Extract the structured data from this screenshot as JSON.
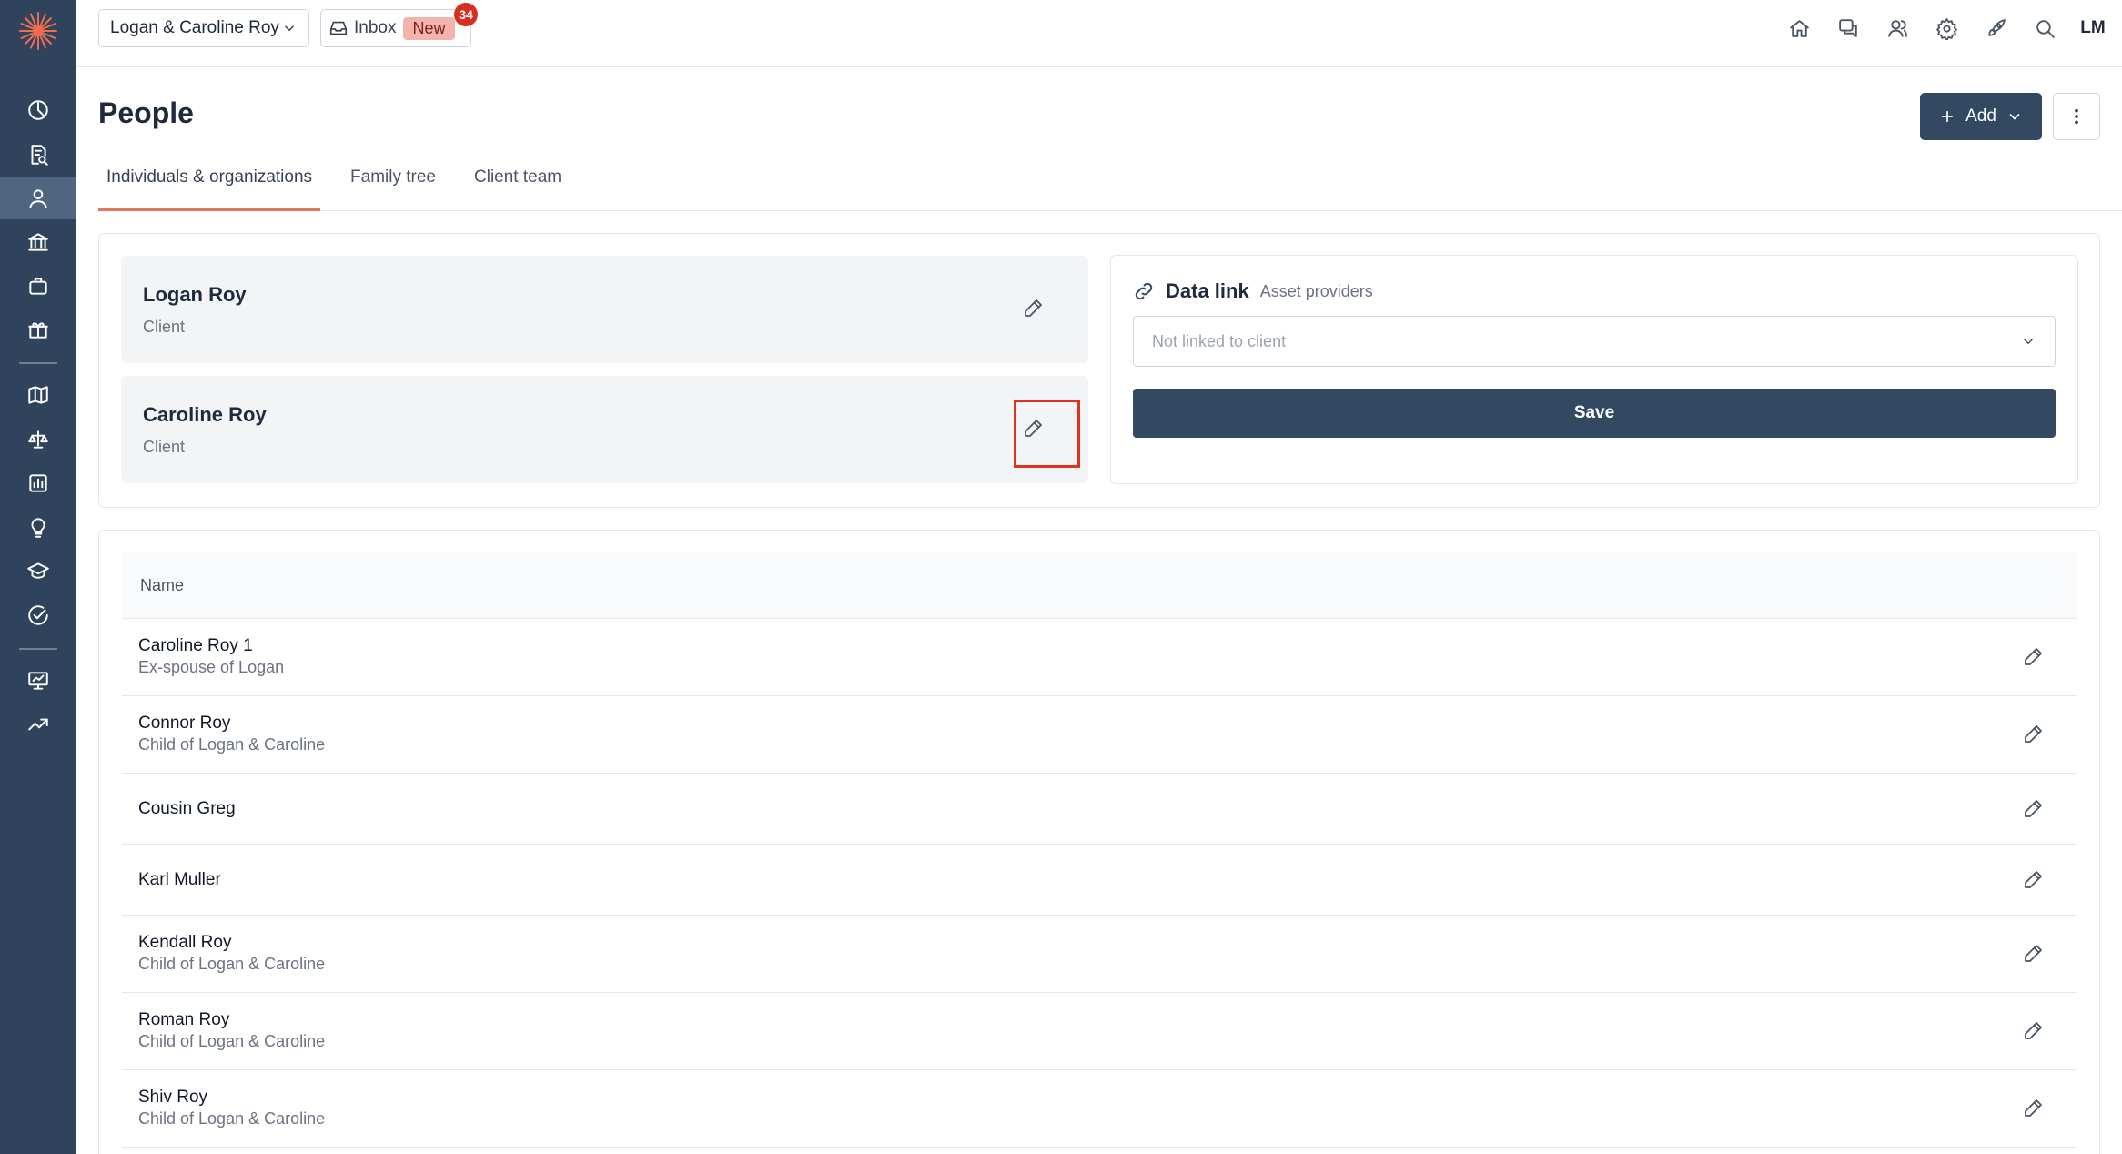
{
  "topbar": {
    "client_name": "Logan & Caroline Roy",
    "inbox_label": "Inbox",
    "inbox_new": "New",
    "inbox_count": "34",
    "avatar_initials": "LM",
    "icons": [
      "home-icon",
      "chat-icon",
      "users-icon",
      "gear-icon",
      "rocket-icon",
      "search-icon"
    ]
  },
  "sidebar": {
    "icons": [
      "dashboard-icon",
      "document-search-icon",
      "person-icon",
      "bank-icon",
      "briefcase-icon",
      "gift-icon",
      "map-icon",
      "balance-icon",
      "chart-icon",
      "lightbulb-icon",
      "graduation-icon",
      "check-circle-icon",
      "presentation-icon",
      "trend-icon"
    ],
    "active": "person-icon"
  },
  "header": {
    "title": "People",
    "add_label": "Add"
  },
  "tabs": [
    {
      "label": "Individuals & organizations",
      "active": true
    },
    {
      "label": "Family tree",
      "active": false
    },
    {
      "label": "Client team",
      "active": false
    }
  ],
  "clients": [
    {
      "name": "Logan Roy",
      "role": "Client"
    },
    {
      "name": "Caroline Roy",
      "role": "Client"
    }
  ],
  "datalink": {
    "title": "Data link",
    "subtitle": "Asset providers",
    "select_placeholder": "Not linked to client",
    "save_label": "Save"
  },
  "table": {
    "header_name": "Name",
    "rows": [
      {
        "name": "Caroline Roy 1",
        "relation": "Ex-spouse of Logan"
      },
      {
        "name": "Connor Roy",
        "relation": "Child of Logan & Caroline"
      },
      {
        "name": "Cousin Greg",
        "relation": ""
      },
      {
        "name": "Karl Muller",
        "relation": ""
      },
      {
        "name": "Kendall Roy",
        "relation": "Child of Logan & Caroline"
      },
      {
        "name": "Roman Roy",
        "relation": "Child of Logan & Caroline"
      },
      {
        "name": "Shiv Roy",
        "relation": "Child of Logan & Caroline"
      }
    ]
  },
  "colors": {
    "sidebar": "#2f435c",
    "primary": "#334861",
    "accent": "#e8745e",
    "badge": "#d92d20",
    "highlight": "#e0321e"
  }
}
